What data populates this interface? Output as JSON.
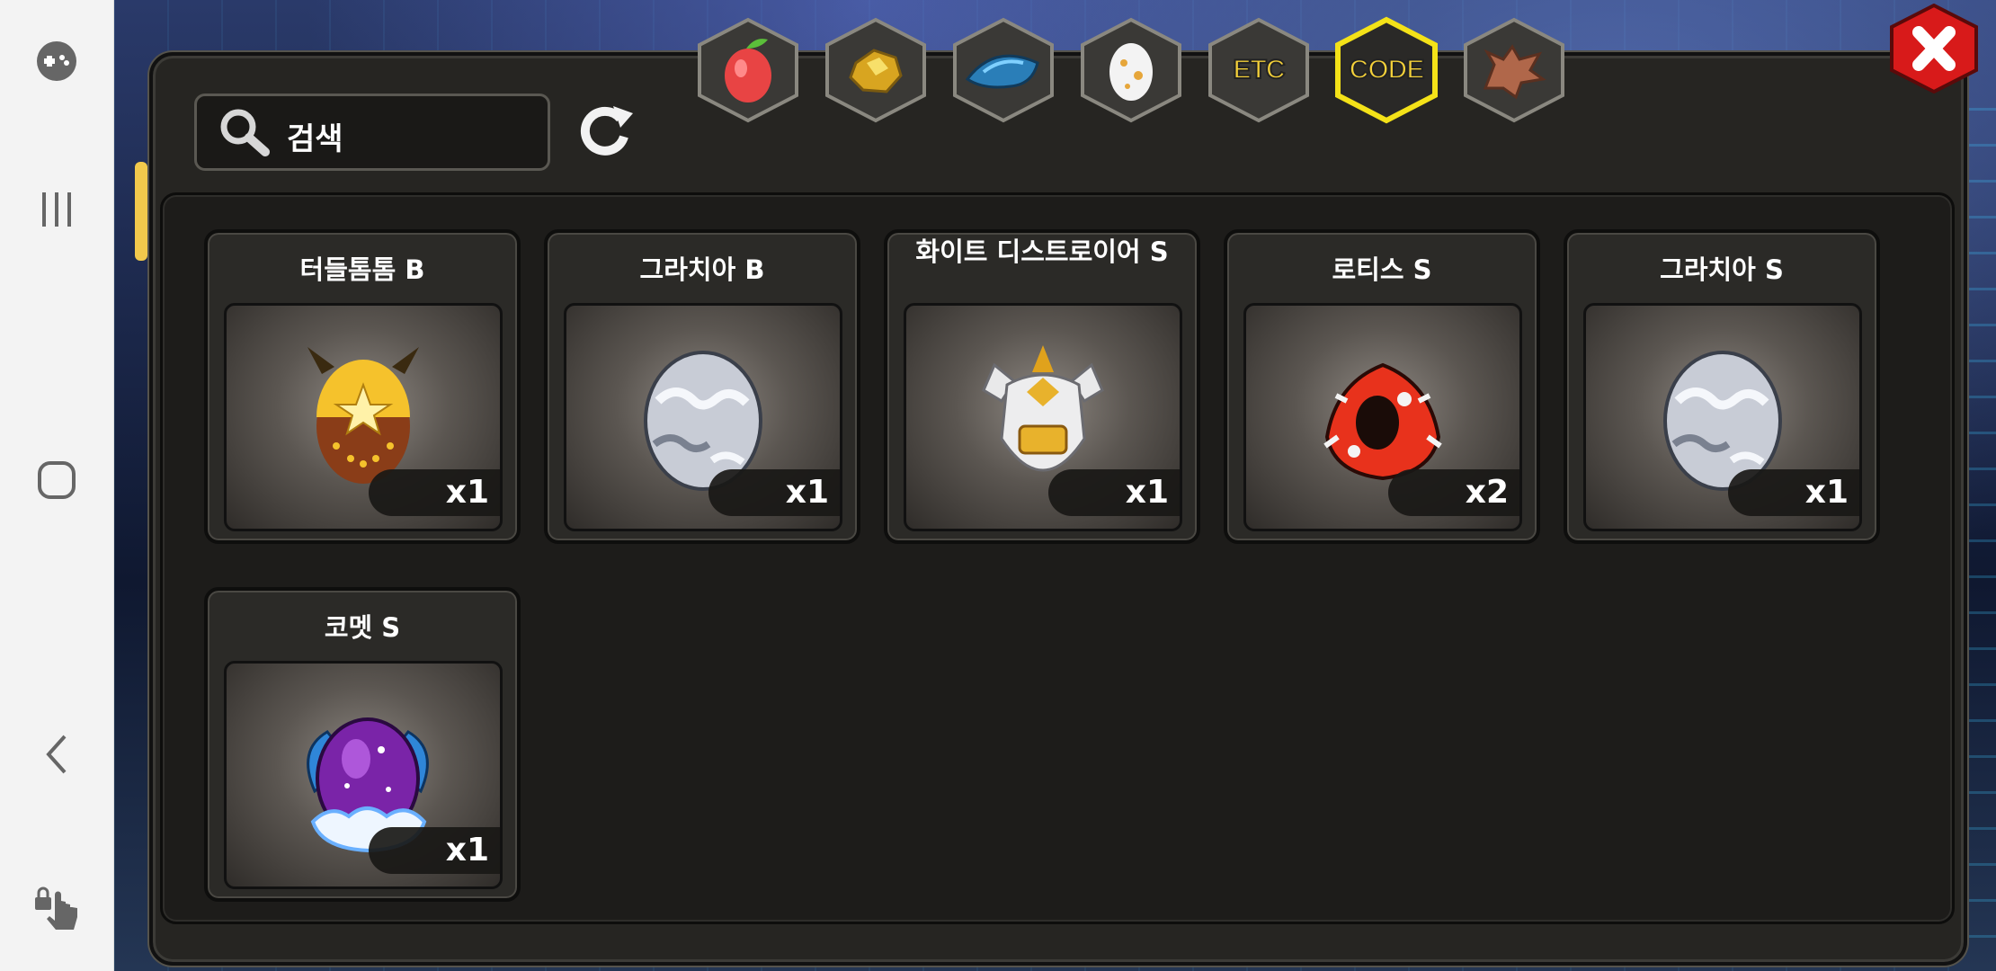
{
  "search": {
    "placeholder": "검색"
  },
  "tabs": [
    {
      "name": "fruit",
      "label": "",
      "icon": "fruit-icon",
      "active": false
    },
    {
      "name": "gold",
      "label": "",
      "icon": "gold-ore-icon",
      "active": false
    },
    {
      "name": "scale",
      "label": "",
      "icon": "dragon-scale-icon",
      "active": false
    },
    {
      "name": "egg",
      "label": "",
      "icon": "egg-icon",
      "active": false
    },
    {
      "name": "etc",
      "label": "ETC",
      "icon": "",
      "active": false
    },
    {
      "name": "code",
      "label": "CODE",
      "icon": "",
      "active": true
    },
    {
      "name": "dragon",
      "label": "",
      "icon": "dragon-head-icon",
      "active": false
    }
  ],
  "items": [
    {
      "name": "터들톰톰 B",
      "qty": "x1",
      "icon": "golden-horned-egg-icon"
    },
    {
      "name": "그라치아 B",
      "qty": "x1",
      "icon": "silver-cloud-egg-icon"
    },
    {
      "name": "화이트 디스트로이어 S",
      "qty": "x1",
      "icon": "white-armored-egg-icon"
    },
    {
      "name": "로티스 S",
      "qty": "x2",
      "icon": "red-black-feather-egg-icon"
    },
    {
      "name": "그라치아 S",
      "qty": "x1",
      "icon": "silver-cloud-egg-icon"
    },
    {
      "name": "코멧 S",
      "qty": "x1",
      "icon": "purple-cosmic-egg-icon"
    }
  ],
  "colors": {
    "tab_active_border": "#f4e218",
    "label_yellow": "#f6d23a",
    "close_red": "#d81a1a"
  }
}
